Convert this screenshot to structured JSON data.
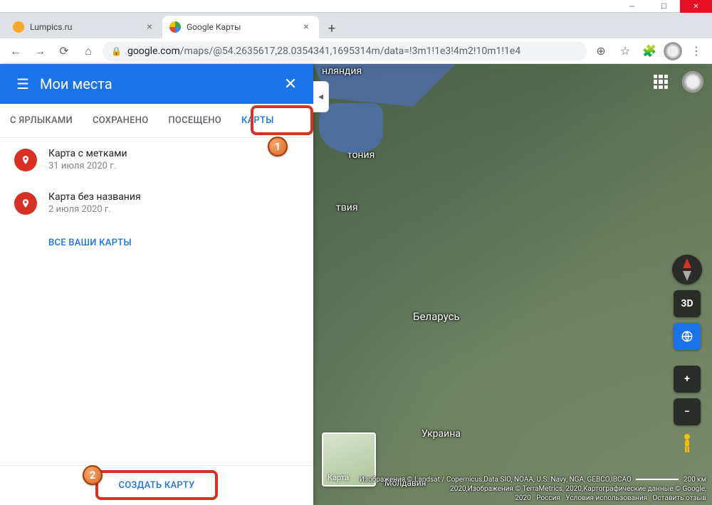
{
  "window": {
    "tabs": [
      {
        "title": "Lumpics.ru",
        "favicon_color": "#f9a825",
        "active": false
      },
      {
        "title": "Google Карты",
        "favicon_color": "#ea4335",
        "active": true
      }
    ]
  },
  "toolbar": {
    "url_host": "google.com",
    "url_path": "/maps/@54.2635617,28.0354341,1695314m/data=!3m1!1e3!4m2!10m1!1e4"
  },
  "panel": {
    "title": "Мои места",
    "tabs": {
      "labels": "С ЯРЛЫКАМИ",
      "saved": "СОХРАНЕНО",
      "visited": "ПОСЕЩЕНО",
      "maps": "КАРТЫ",
      "active": "maps"
    },
    "map_items": [
      {
        "title": "Карта с метками",
        "subtitle": "31 июля 2020 г."
      },
      {
        "title": "Карта без названия",
        "subtitle": "2 июля 2020 г."
      }
    ],
    "all_maps_link": "ВСЕ ВАШИ КАРТЫ",
    "create_button": "СОЗДАТЬ КАРТУ"
  },
  "callouts": {
    "one": "1",
    "two": "2"
  },
  "map": {
    "labels": {
      "finland": "нляндия",
      "estonia": "тония",
      "latvia": "твия",
      "belarus": "Беларусь",
      "ukraine": "Украина",
      "moldova": "Молдавия",
      "minimap": "Карта"
    },
    "buttons": {
      "threeD": "3D"
    },
    "attribution": {
      "line1_prefix": "Изображения © Landsat / Copernicus,Data SIO, NOAA, U.S. Navy, NGA, GEBCO,IBCAO",
      "scale_value": "200 км",
      "line2": "2020,Изображения © TerraMetrics, 2020,Картографические данные © Google,",
      "line3_year": "2020",
      "line3_country": "Россия",
      "line3_terms": "Условия использования",
      "line3_feedback": "Оставить отзыв"
    }
  }
}
